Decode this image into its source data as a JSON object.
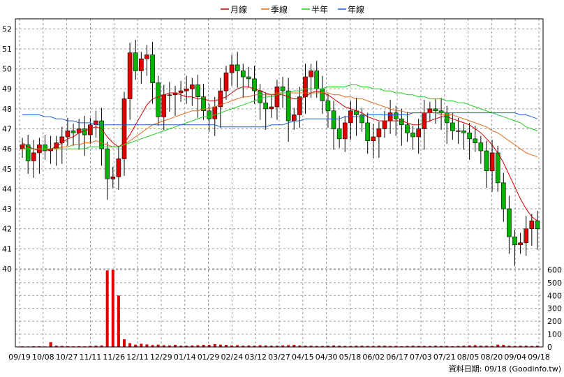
{
  "legend": [
    {
      "label": "月線",
      "color": "#cc0000"
    },
    {
      "label": "季線",
      "color": "#e06a1a"
    },
    {
      "label": "半年",
      "color": "#22cc22"
    },
    {
      "label": "年線",
      "color": "#1f5fd0"
    }
  ],
  "footer": "資料日期: 09/18 (Goodinfo.tw)",
  "chart_data": {
    "type": "candlestick",
    "price_axis": {
      "ylim": [
        40,
        52.5
      ],
      "ticks": [
        40,
        41,
        42,
        43,
        44,
        45,
        46,
        47,
        48,
        49,
        50,
        51,
        52
      ]
    },
    "volume_axis": {
      "ylim": [
        0,
        640
      ],
      "ticks": [
        0,
        100,
        200,
        300,
        400,
        500,
        600
      ]
    },
    "x_labels": [
      "09/19",
      "10/08",
      "10/27",
      "11/11",
      "11/26",
      "12/11",
      "12/29",
      "01/14",
      "01/29",
      "02/24",
      "03/12",
      "03/27",
      "04/15",
      "04/30",
      "05/18",
      "06/02",
      "06/17",
      "07/03",
      "07/21",
      "08/05",
      "08/20",
      "09/04",
      "09/18"
    ],
    "close": [
      46.2,
      45.4,
      45.8,
      46.2,
      45.9,
      46.0,
      46.3,
      46.6,
      46.9,
      46.8,
      47.0,
      46.7,
      47.2,
      47.4,
      46.0,
      44.5,
      44.6,
      45.5,
      48.5,
      50.8,
      49.9,
      50.5,
      50.7,
      49.3,
      47.6,
      48.7,
      48.7,
      48.8,
      48.9,
      49.0,
      49.2,
      48.6,
      47.9,
      47.5,
      48.1,
      48.9,
      49.8,
      50.2,
      49.9,
      49.6,
      49.5,
      48.9,
      48.3,
      48.0,
      48.1,
      49.1,
      48.9,
      47.4,
      47.7,
      48.6,
      49.6,
      49.9,
      49.0,
      48.4,
      47.9,
      47.0,
      46.5,
      47.3,
      47.9,
      47.7,
      47.3,
      46.4,
      46.6,
      47.0,
      47.4,
      47.8,
      47.5,
      47.2,
      46.8,
      46.6,
      47.0,
      47.8,
      48.0,
      47.9,
      47.8,
      47.3,
      46.9,
      46.9,
      46.8,
      46.5,
      46.3,
      45.9,
      44.9,
      45.8,
      44.3,
      43.0,
      41.6,
      41.2,
      41.3,
      42.0,
      42.4,
      42.0
    ],
    "volume": [
      5,
      4,
      6,
      6,
      4,
      38,
      10,
      8,
      6,
      5,
      6,
      5,
      8,
      10,
      12,
      595,
      600,
      400,
      60,
      30,
      18,
      25,
      20,
      15,
      18,
      14,
      12,
      16,
      10,
      10,
      12,
      14,
      16,
      16,
      22,
      18,
      16,
      12,
      14,
      10,
      12,
      10,
      14,
      12,
      10,
      10,
      12,
      14,
      16,
      12,
      10,
      10,
      8,
      8,
      10,
      12,
      10,
      8,
      8,
      10,
      10,
      8,
      8,
      10,
      10,
      8,
      8,
      6,
      8,
      10,
      8,
      8,
      8,
      10,
      8,
      8,
      6,
      8,
      10,
      12,
      14,
      10,
      10,
      8,
      18,
      16,
      10,
      8,
      10,
      10,
      8,
      10
    ],
    "series": [
      {
        "name": "月線",
        "values": [
          46.3,
          46.1,
          46.0,
          45.9,
          45.9,
          46.0,
          46.1,
          46.3,
          46.5,
          46.6,
          46.8,
          46.9,
          47.0,
          47.1,
          47.0,
          46.6,
          46.3,
          46.1,
          46.3,
          46.7,
          47.2,
          47.7,
          48.2,
          48.5,
          48.6,
          48.7,
          48.8,
          48.8,
          48.7,
          48.6,
          48.6,
          48.5,
          48.5,
          48.4,
          48.4,
          48.5,
          48.6,
          48.8,
          49.0,
          49.1,
          49.1,
          49.0,
          48.9,
          48.8,
          48.7,
          48.7,
          48.7,
          48.6,
          48.5,
          48.5,
          48.6,
          48.8,
          48.9,
          48.8,
          48.7,
          48.5,
          48.3,
          48.1,
          48.0,
          47.9,
          47.8,
          47.6,
          47.5,
          47.4,
          47.4,
          47.4,
          47.4,
          47.4,
          47.3,
          47.2,
          47.2,
          47.3,
          47.4,
          47.5,
          47.6,
          47.6,
          47.5,
          47.4,
          47.3,
          47.2,
          47.0,
          46.8,
          46.5,
          46.2,
          45.8,
          45.3,
          44.7,
          44.1,
          43.5,
          43.0,
          42.6,
          42.4
        ]
      },
      {
        "name": "季線",
        "values": [
          46.0,
          46.0,
          46.0,
          46.0,
          46.0,
          46.0,
          46.0,
          46.1,
          46.1,
          46.2,
          46.2,
          46.3,
          46.3,
          46.4,
          46.3,
          46.2,
          46.1,
          46.1,
          46.2,
          46.4,
          46.6,
          46.8,
          47.0,
          47.2,
          47.3,
          47.4,
          47.5,
          47.6,
          47.7,
          47.8,
          47.9,
          47.9,
          48.0,
          48.0,
          48.1,
          48.2,
          48.3,
          48.4,
          48.5,
          48.6,
          48.6,
          48.7,
          48.7,
          48.7,
          48.7,
          48.8,
          48.8,
          48.8,
          48.8,
          48.8,
          48.8,
          48.8,
          48.8,
          48.8,
          48.8,
          48.7,
          48.7,
          48.6,
          48.6,
          48.5,
          48.5,
          48.4,
          48.3,
          48.2,
          48.1,
          48.0,
          47.9,
          47.9,
          47.8,
          47.8,
          47.8,
          47.8,
          47.8,
          47.8,
          47.7,
          47.7,
          47.7,
          47.6,
          47.5,
          47.4,
          47.3,
          47.2,
          47.1,
          46.9,
          46.8,
          46.6,
          46.4,
          46.2,
          46.0,
          45.8,
          45.7,
          45.6
        ]
      },
      {
        "name": "半年",
        "values": [
          46.0,
          46.0,
          46.0,
          46.0,
          46.0,
          46.0,
          46.0,
          46.0,
          46.0,
          46.0,
          46.0,
          46.0,
          46.1,
          46.1,
          46.1,
          46.1,
          46.1,
          46.1,
          46.2,
          46.3,
          46.4,
          46.5,
          46.6,
          46.7,
          46.8,
          46.9,
          47.0,
          47.1,
          47.2,
          47.3,
          47.4,
          47.5,
          47.6,
          47.6,
          47.7,
          47.8,
          47.9,
          48.0,
          48.1,
          48.2,
          48.3,
          48.4,
          48.5,
          48.6,
          48.6,
          48.7,
          48.8,
          48.8,
          48.9,
          48.9,
          49.0,
          49.0,
          49.0,
          49.0,
          49.1,
          49.1,
          49.1,
          49.1,
          49.2,
          49.2,
          49.1,
          49.1,
          49.0,
          49.0,
          48.9,
          48.9,
          48.8,
          48.8,
          48.7,
          48.7,
          48.6,
          48.6,
          48.5,
          48.5,
          48.5,
          48.4,
          48.4,
          48.3,
          48.3,
          48.2,
          48.1,
          48.0,
          47.9,
          47.8,
          47.7,
          47.6,
          47.5,
          47.4,
          47.3,
          47.1,
          47.0,
          46.9
        ]
      },
      {
        "name": "年線",
        "values": [
          47.7,
          47.7,
          47.7,
          47.7,
          47.6,
          47.6,
          47.5,
          47.5,
          47.4,
          47.4,
          47.3,
          47.3,
          47.3,
          47.2,
          47.2,
          47.2,
          47.2,
          47.2,
          47.2,
          47.2,
          47.2,
          47.2,
          47.2,
          47.2,
          47.2,
          47.2,
          47.2,
          47.2,
          47.2,
          47.2,
          47.2,
          47.2,
          47.2,
          47.2,
          47.2,
          47.1,
          47.1,
          47.1,
          47.1,
          47.1,
          47.1,
          47.1,
          47.1,
          47.1,
          47.2,
          47.2,
          47.2,
          47.3,
          47.4,
          47.4,
          47.5,
          47.5,
          47.5,
          47.5,
          47.5,
          47.5,
          47.5,
          47.6,
          47.6,
          47.6,
          47.6,
          47.7,
          47.7,
          47.7,
          47.7,
          47.7,
          47.7,
          47.7,
          47.7,
          47.8,
          47.8,
          47.8,
          47.8,
          47.8,
          47.8,
          47.8,
          47.8,
          47.8,
          47.8,
          47.8,
          47.8,
          47.8,
          47.8,
          47.8,
          47.8,
          47.8,
          47.8,
          47.8,
          47.7,
          47.7,
          47.6,
          47.5
        ]
      }
    ],
    "grid": true,
    "legend_position": "top-center"
  }
}
